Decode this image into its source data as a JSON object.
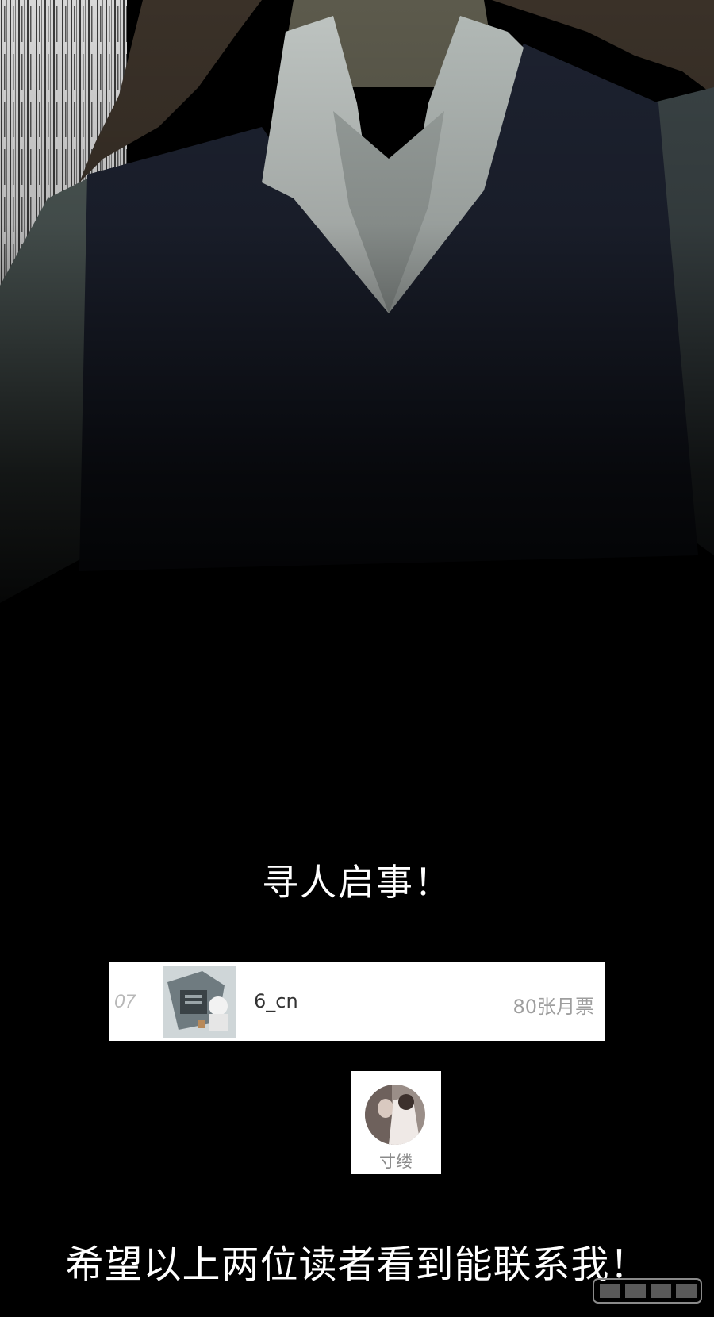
{
  "heading": "寻人启事！",
  "ranking_entry": {
    "rank": "07",
    "username": "6_cn",
    "votes": "80张月票"
  },
  "user_card": {
    "username": "寸缕"
  },
  "message": "希望以上两位读者看到能联系我！",
  "icons": {
    "rank_avatar": "comic-avatar-image",
    "user_avatar": "round-photo-avatar",
    "watermark": "publisher-logo"
  },
  "colors": {
    "background": "#000000",
    "vest": "#1d2230",
    "shirt": "#bfc5c2",
    "hair": "#3a3128",
    "card": "#ffffff"
  }
}
